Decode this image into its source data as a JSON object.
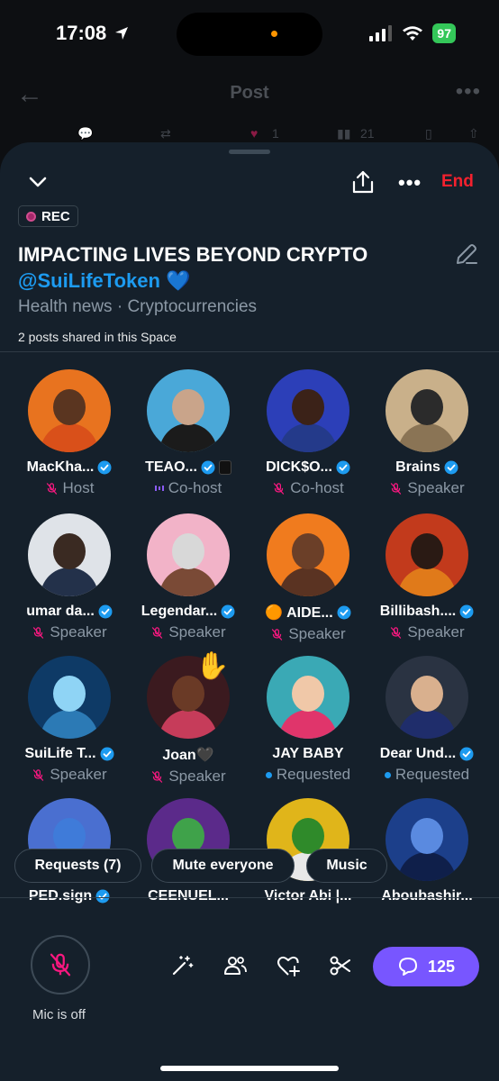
{
  "status_bar": {
    "time": "17:08",
    "battery": "97"
  },
  "post_header": {
    "title": "Post",
    "likes": "1",
    "views": "21"
  },
  "sheet": {
    "end_label": "End",
    "rec_label": "REC",
    "title": "IMPACTING LIVES BEYOND CRYPTO",
    "handle": "@SuiLifeToken",
    "handle_emoji": "💙",
    "topics": "Health news · Cryptocurrencies",
    "posts_shared": "2 posts shared in this Space"
  },
  "participants": [
    {
      "name": "MacKha...",
      "role": "Host",
      "status": "muted",
      "verified": true,
      "bg": "#e8731f",
      "face": "#5a3520",
      "body": "#d9501a"
    },
    {
      "name": "TEAO...",
      "role": "Co-host",
      "status": "speaking",
      "verified": true,
      "bg": "#4aa8d8",
      "face": "#c9a48a",
      "body": "#1b1b1b",
      "extra_badge": true
    },
    {
      "name": "DICK$O...",
      "role": "Co-host",
      "status": "muted",
      "verified": true,
      "bg": "#2c3fb8",
      "face": "#3b2218",
      "body": "#243a8a"
    },
    {
      "name": "Brains",
      "role": "Speaker",
      "status": "muted",
      "verified": true,
      "bg": "#c9b08a",
      "face": "#2b2b2b",
      "body": "#8a7455"
    },
    {
      "name": "umar da...",
      "role": "Speaker",
      "status": "muted",
      "verified": true,
      "bg": "#dfe3e8",
      "face": "#3a2a22",
      "body": "#23314a"
    },
    {
      "name": "Legendar...",
      "role": "Speaker",
      "status": "muted",
      "verified": true,
      "bg": "#f2b3c8",
      "face": "#d8d8d8",
      "body": "#7a4a36"
    },
    {
      "name": "🟠 AIDE...",
      "role": "Speaker",
      "status": "muted",
      "verified": true,
      "bg": "#f07b1e",
      "face": "#6b3f28",
      "body": "#5a3322"
    },
    {
      "name": "Billibash....",
      "role": "Speaker",
      "status": "muted",
      "verified": true,
      "bg": "#c23a1c",
      "face": "#2a1a14",
      "body": "#e07a1a"
    },
    {
      "name": "SuiLife T...",
      "role": "Speaker",
      "status": "muted",
      "verified": true,
      "bg": "#0e3a66",
      "face": "#8fd4f5",
      "body": "#2c7ab5"
    },
    {
      "name": "Joan🖤",
      "role": "Speaker",
      "status": "muted",
      "verified": false,
      "bg": "#3b1a1f",
      "face": "#6a3a26",
      "body": "#c63c5a",
      "hand": "✋"
    },
    {
      "name": "JAY BABY",
      "role": "Requested",
      "status": "requested",
      "verified": false,
      "bg": "#3aa9b5",
      "face": "#f0c8a8",
      "body": "#e0356b"
    },
    {
      "name": "Dear Und...",
      "role": "Requested",
      "status": "requested",
      "verified": true,
      "bg": "#2a3342",
      "face": "#d9b08e",
      "body": "#1f2d6b"
    },
    {
      "name": "PED.sign",
      "role": "",
      "status": "",
      "verified": true,
      "bg": "#4a6fd0",
      "face": "#3f7bd9",
      "body": "#5a3f8a"
    },
    {
      "name": "CEENUEL...",
      "role": "",
      "status": "",
      "verified": false,
      "bg": "#5b2a8a",
      "face": "#3fa24a",
      "body": "#2a6b3a"
    },
    {
      "name": "Victor Abi |...",
      "role": "",
      "status": "",
      "verified": false,
      "bg": "#e0b51a",
      "face": "#2f8a2a",
      "body": "#e8e8e8"
    },
    {
      "name": "Aboubashir...",
      "role": "",
      "status": "",
      "verified": false,
      "bg": "#1c3f8a",
      "face": "#5a8ae0",
      "body": "#0f1f4a"
    }
  ],
  "pills": {
    "requests": "Requests (7)",
    "mute_everyone": "Mute everyone",
    "music": "Music"
  },
  "bottom": {
    "mic_label": "Mic is off",
    "chat_count": "125"
  },
  "colors": {
    "accent": "#1d9bf0",
    "end": "#f4212e",
    "chat": "#7856ff",
    "mute_icon": "#f91880"
  }
}
